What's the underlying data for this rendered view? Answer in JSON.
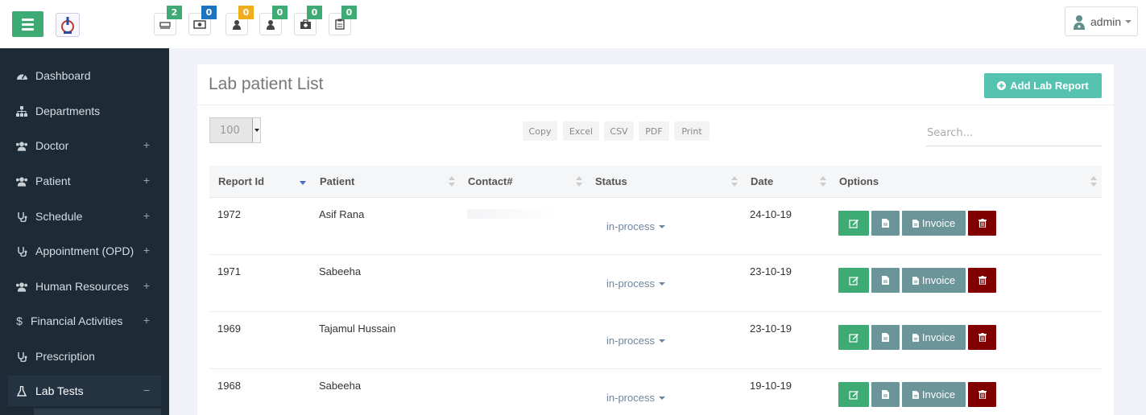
{
  "header": {
    "notifications": [
      {
        "icon": "hospital-bed-icon",
        "count": "2",
        "color": "#3eab75"
      },
      {
        "icon": "money-icon",
        "count": "0",
        "color": "#1e73be"
      },
      {
        "icon": "user-icon",
        "count": "0",
        "color": "#f0ad1e"
      },
      {
        "icon": "user-icon",
        "count": "0",
        "color": "#3eab75"
      },
      {
        "icon": "medical-kit-icon",
        "count": "0",
        "color": "#3eab75"
      },
      {
        "icon": "clipboard-icon",
        "count": "0",
        "color": "#3eab75"
      }
    ],
    "user": "admin"
  },
  "sidebar": {
    "items": [
      {
        "label": "Dashboard",
        "icon": "dashboard-icon",
        "expandable": false
      },
      {
        "label": "Departments",
        "icon": "sitemap-icon",
        "expandable": false
      },
      {
        "label": "Doctor",
        "icon": "users-icon",
        "expandable": true,
        "toggle": "+"
      },
      {
        "label": "Patient",
        "icon": "users-icon",
        "expandable": true,
        "toggle": "+"
      },
      {
        "label": "Schedule",
        "icon": "stethoscope-icon",
        "expandable": true,
        "toggle": "+"
      },
      {
        "label": "Appointment (OPD)",
        "icon": "stethoscope-icon",
        "expandable": true,
        "toggle": "+"
      },
      {
        "label": "Human Resources",
        "icon": "users-icon",
        "expandable": true,
        "toggle": "+"
      },
      {
        "label": "Financial Activities",
        "icon": "dollar-icon",
        "expandable": true,
        "toggle": "+"
      },
      {
        "label": "Prescription",
        "icon": "stethoscope-icon",
        "expandable": false
      },
      {
        "label": "Lab Tests",
        "icon": "flask-icon",
        "expandable": true,
        "toggle": "−",
        "active": true
      }
    ]
  },
  "main": {
    "title": "Lab patient List",
    "add_button": "Add Lab Report",
    "page_length": "100",
    "export_buttons": [
      "Copy",
      "Excel",
      "CSV",
      "PDF",
      "Print"
    ],
    "search_placeholder": "Search...",
    "columns": [
      "Report Id",
      "Patient",
      "Contact#",
      "Status",
      "Date",
      "Options"
    ],
    "rows": [
      {
        "id": "1972",
        "patient": "Asif Rana",
        "status": "in-process",
        "date": "24-10-19"
      },
      {
        "id": "1971",
        "patient": "Sabeeha",
        "status": "in-process",
        "date": "23-10-19"
      },
      {
        "id": "1969",
        "patient": "Tajamul Hussain",
        "status": "in-process",
        "date": "23-10-19"
      },
      {
        "id": "1968",
        "patient": "Sabeeha",
        "status": "in-process",
        "date": "19-10-19"
      }
    ],
    "invoice_label": "Invoice"
  }
}
